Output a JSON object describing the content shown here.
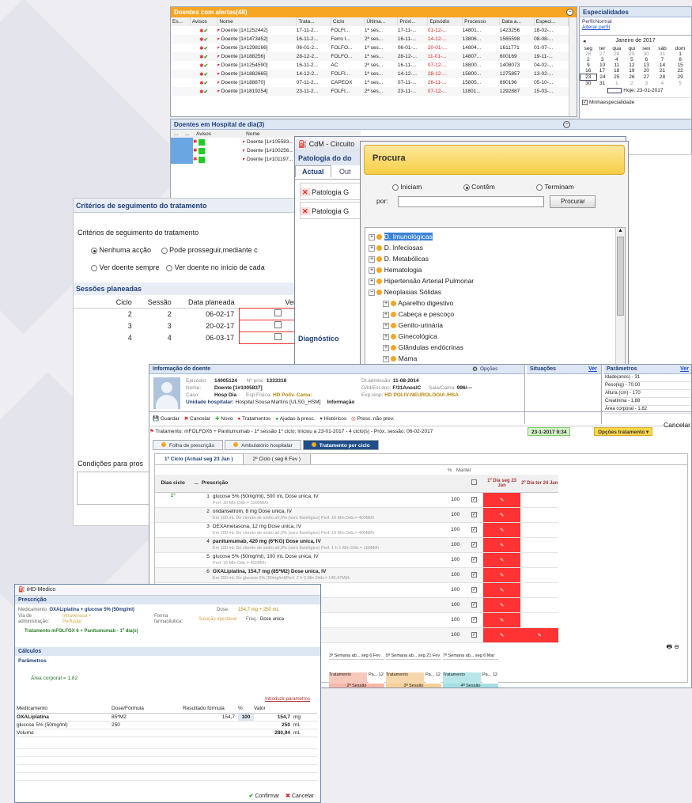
{
  "alertas": {
    "title": "Doentes com alertas(48)",
    "cols": [
      "Es...",
      "Avisos",
      "Nome",
      "Trata...",
      "Ciclo",
      "Última...",
      "Próxi...",
      "Episódio",
      "Processo",
      "Data a...",
      "Especi..."
    ],
    "rows": [
      [
        "Doente [1#1252442]",
        "17-11-2...",
        "FOLFI...",
        "1ª ses...",
        "17-11-...",
        "01-12-...",
        "14801...",
        "1423256",
        "18-02-..."
      ],
      [
        "Doente [1#1473452]",
        "16-11-2...",
        "Ferro I...",
        "2ª ses...",
        "16-11-...",
        "14-12-...",
        "13806...",
        "1565598",
        "08-08-..."
      ],
      [
        "Doente [1#1298166]",
        "06-01-2...",
        "FOLFO...",
        "1ª ses...",
        "06-01-...",
        "20-01-...",
        "14804...",
        "1611771",
        "01-07-..."
      ],
      [
        "Doente [1#188256]",
        "28-12-2...",
        "FOLFO...",
        "1ª ses...",
        "28-12-...",
        "11-01-...",
        "14807...",
        "600169",
        "19-11-..."
      ],
      [
        "Doente [1#1254590]",
        "16-11-2...",
        "AC",
        "2ª ses...",
        "16-11-...",
        "07-12-...",
        "18800...",
        "1408073",
        "04-02-..."
      ],
      [
        "Doente [1#1882665]",
        "14-12-2...",
        "FOLFI...",
        "1ª ses...",
        "14-12-...",
        "28-12-...",
        "15800...",
        "1275857",
        "13-02-..."
      ],
      [
        "Doente [1#188870]",
        "07-11-2...",
        "CAPEOX",
        "1ª ses...",
        "07-11-...",
        "28-11-...",
        "15805...",
        "690196",
        "05-10-..."
      ],
      [
        "Doente [1#1819254]",
        "23-11-2...",
        "FOLFI...",
        "2ª ses...",
        "23-11-...",
        "07-12-...",
        "11801...",
        "1292887",
        "15-03-..."
      ]
    ]
  },
  "especialidades": {
    "title": "Especialidades",
    "perfil": "Perfil:Normal",
    "alterar": "Alterar perfil",
    "month": "Janeiro de 2017",
    "days": [
      "seg",
      "ter",
      "qua",
      "qui",
      "sex",
      "sáb",
      "dom"
    ],
    "weeks": [
      [
        "26",
        "27",
        "28",
        "29",
        "30",
        "31",
        "1"
      ],
      [
        "2",
        "3",
        "4",
        "5",
        "6",
        "7",
        "8"
      ],
      [
        "9",
        "10",
        "11",
        "12",
        "13",
        "14",
        "15"
      ],
      [
        "16",
        "17",
        "18",
        "19",
        "20",
        "21",
        "22"
      ],
      [
        "23",
        "24",
        "25",
        "26",
        "27",
        "28",
        "29"
      ],
      [
        "30",
        "31",
        "1",
        "2",
        "3",
        "4",
        "5"
      ]
    ],
    "hoje": "Hoje: 23-01-2017",
    "minha": "Minhaespecialidade"
  },
  "hospital": {
    "title": "Doentes em Hospital de dia(3)",
    "cols": [
      "...",
      "...",
      "Avisos",
      "Nome"
    ],
    "rows": [
      "Doente [1#105583...",
      "Doente [1#100256...",
      "Doente [1#101197..."
    ]
  },
  "cdm": {
    "title": "CdM - Circuito",
    "patologia": "Patologia do do",
    "tab_actual": "Actual",
    "tab_out": "Out",
    "rows": [
      "Patologia G",
      "Patologia G"
    ],
    "diagnostico": "Diagnóstico"
  },
  "procura": {
    "title": "Procura",
    "opt1": "Iniciam",
    "opt2": "Contêm",
    "opt3": "Terminam",
    "por": "por:",
    "procurar": "Procurar",
    "tree": [
      "D. Imunológicas",
      "D. Infeciosas",
      "D. Metabólicas",
      "Hematologia",
      "Hipertensão Arterial Pulmonar",
      "Neoplasias Sólidas"
    ],
    "sub": [
      "Aparelho digestivo",
      "Cabeça e pescoço",
      "Genito-urinária",
      "Ginecológica",
      "Glândulas endócrinas",
      "Mama",
      "Neoplasias múltiplas"
    ]
  },
  "criterios": {
    "title": "Critérios de seguimento do tratamento",
    "group": "Critérios de seguimento do tratamento",
    "r1": "Nenhuma acção",
    "r2": "Pode prosseguir,mediante c",
    "r3": "Ver doente sempre",
    "r4": "Ver doente no início de cada",
    "sessoes": "Sessões planeadas",
    "cols": [
      "Ciclo",
      "Sessão",
      "Data planeada",
      "Ver do"
    ],
    "rows": [
      [
        "2",
        "2",
        "06-02-17"
      ],
      [
        "3",
        "3",
        "20-02-17"
      ],
      [
        "4",
        "4",
        "06-03-17"
      ]
    ],
    "condicoes": "Condições para pros"
  },
  "info": {
    "title": "Informação do doente",
    "episodio_l": "Episódio:",
    "episodio": "14005124",
    "processo_l": "Nº proc:",
    "processo": "1333318",
    "nome_l": "Nome:",
    "nome": "Doente [1#1005837]",
    "caso_l": "Caso:",
    "caso": "Hosp Dia",
    "esp_l": "Esp.Física:",
    "esp": "HD Poliv. Cama:",
    "unidade_l": "Unidade hospitalar:",
    "unidade": "Hospital Sousa Martins [ULSG_HSM]",
    "infor": "Informação",
    "dt_l": "Dt.admissão:",
    "dt": "11-08-2014",
    "gd_l": "G/Id/Est.doc:",
    "gd": "F/31Anos/C",
    "cama_l": "Sala/Cama:",
    "cama": "996/---",
    "exp_l": "Exp.resp:",
    "exp": "HD POLIV-NEUROLOGIA /HSA",
    "opcoes": "Opções",
    "situacoes": "Situações",
    "ver": "Ver",
    "parametros": "Parâmetros",
    "params": [
      "Idade(anos) - 31",
      "Peso(kg) - 70,00",
      "Altura (cm) - 170",
      "Creatinina - 1,88",
      "Área corporal - 1,82"
    ],
    "toolbar": [
      "Guardar",
      "Cancelar",
      "Novo",
      "Tratamentos",
      "Ajudas à presc.",
      "Históricos",
      "Presc. não prev."
    ],
    "tratamento": "Tratamento: mFOLFOX6 + Panitumumab - 1ª sessão 1º ciclo; Iniciou a 23-01-2017 - 4 ciclo(s) - Próx. sessão: 06-02-2017",
    "data": "23-1-2017 9:34",
    "opcoes_trat": "Opções tratamento",
    "cancelar": "Cancelar",
    "tabs": [
      "Folha de prescrição",
      "Ambulatório hospitalar",
      "Tratamento por ciclo"
    ],
    "ciclo_tabs": [
      "1º Ciclo (Actual seg 23 Jan )",
      "2º Ciclo ( seg 6 Fev )"
    ],
    "grid_cols": [
      "Dias ciclo",
      "...",
      "Prescrição",
      "%",
      "Manter"
    ],
    "dia1": "1º Dia seg 23 Jan",
    "dia2": "2º Dia ter 24 Jan",
    "ciclo_label": "1º",
    "presc": [
      {
        "n": "1",
        "t": "glucose 5% (50mg/ml), 500 mL Dose unica, IV",
        "s": "Perf. 30 Min Déb.= 1000Ml/h",
        "p": "100"
      },
      {
        "n": "2",
        "t": "ondansetrom, 8 mg Dose unica, IV",
        "s": "Em 100 mL De cloreto de sódio a0,9% (soro fisiológico) Perf. 15 Min Déb.= 400Ml/h",
        "p": "100"
      },
      {
        "n": "3",
        "t": "DEXAmetasona, 12 mg Dose unica, IV",
        "s": "Em 100 mL De cloreto de sódio a0,9% (soro fisiológico) Perf. 15 Min Déb.= 400Ml/h",
        "p": "100"
      },
      {
        "n": "4",
        "t": "panitumumab, 420 mg (6*KG) Dose unica, IV",
        "s": "Em 100 mL De cloreto de sódio a0,9% (soro fisiológico) Perf. 1 h 1 Min Déb.= 100Ml/h",
        "p": "100"
      },
      {
        "n": "5",
        "t": "glucose 5% (50mg/ml), 100 mL Dose unica, IV",
        "s": "Perf. 15 Min Déb.= 400Ml/h",
        "p": "100"
      },
      {
        "n": "6",
        "t": "OXALiplatina, 154,7 mg (85*M2) Dose unica, IV",
        "s": "Em 250 mL De glucose 5% (50mg/ml)Perf. 2 h 0 Min Déb.= 140,47Ml/h",
        "p": "100"
      },
      {
        "n": "7",
        "t": "Dose unica, IV",
        "s": "Perf. 2 h 0 Min Déb.= 145,82Ml/h",
        "p": "100"
      },
      {
        "n": "8",
        "t": ", IV",
        "s": "",
        "p": "100"
      },
      {
        "n": "9",
        "t": "unica, IV",
        "s": "",
        "p": "100"
      },
      {
        "n": "10",
        "t": "ntinua, IV",
        "s": "fiológico) Perf. Déb.= 349,44Ml/h",
        "p": "100"
      }
    ],
    "semanas": [
      "3ª Semana ab... seg 6 Fev",
      "5ª Semana ab... seg 21 Fev",
      "7ª Semana ab... seg 6 Mar"
    ],
    "tl_rows": [
      [
        "Tratamento",
        "Pa... 12",
        "Tratamento",
        "Pa... 12",
        "Tratamento",
        "Pa... 12"
      ],
      [
        "2ª Sessão",
        "3ª Sessão",
        "4ª Sessão"
      ],
      [
        "2º Ciclo",
        "3º Ciclo",
        "4º Ciclo"
      ]
    ]
  },
  "medico": {
    "title": "iHD-Medico",
    "prescricao": "Prescrição",
    "med_l": "Medicamento:",
    "med": "OXALiplatina + glucose 5% (50mg/ml)",
    "dose_l": "Dose:",
    "dose": "154,7 mg + 250 mL",
    "via_l": "Via de administração:",
    "via": "Intravenosa + Perfusão",
    "forma_l": "Forma farmacêutica:",
    "forma": "Solução injectável",
    "freq_l": "Freq.:",
    "freq": "Dose unica",
    "tratamento": "Tratamento mFOLFOX 6 + Panitumumab - 1º dia(s)",
    "calculos": "Cálculos",
    "parametros": "Parâmetros",
    "area": "Área corporal = 1,82",
    "introduzir": "Introduzir parametros",
    "cols": [
      "Medicamento",
      "Dose/Fórmula",
      "Resultado fórmula",
      "%",
      "Valor"
    ],
    "rows": [
      [
        "OXALiplatina",
        "85*M2",
        "154,7",
        "100",
        "154,7",
        "mg"
      ],
      [
        "glucose 5% (50mg/ml)",
        "250",
        "",
        "",
        "250",
        "mL"
      ],
      [
        "Volume",
        "",
        "",
        "",
        "280,94",
        "mL"
      ]
    ],
    "confirmar": "Confirmar",
    "cancelar": "Cancelar"
  }
}
